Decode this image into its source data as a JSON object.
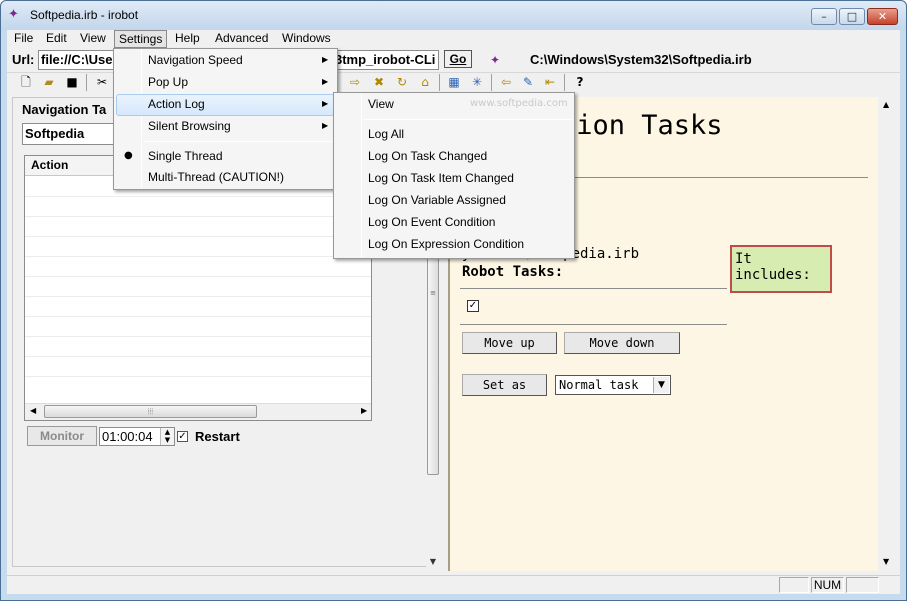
{
  "window": {
    "title": "Softpedia.irb - irobot",
    "minimize": "–",
    "maximize": "□",
    "close": "✕"
  },
  "menubar": {
    "items": [
      "File",
      "Edit",
      "View",
      "Settings",
      "Help",
      "Advanced",
      "Windows"
    ]
  },
  "urlbar": {
    "label": "Url:",
    "value": "file://C:\\Use",
    "value_tail": "3tmp_irobot-CLi",
    "go": "Go",
    "path": "C:\\Windows\\System32\\Softpedia.irb"
  },
  "left": {
    "title": "Navigation Ta",
    "combo_value": "Softpedia",
    "list_header": "Action",
    "monitor": "Monitor",
    "time": "01:00:04",
    "restart": "Restart"
  },
  "settings_menu": {
    "items": [
      {
        "label": "Navigation Speed"
      },
      {
        "label": "Pop Up"
      },
      {
        "label": "Action Log"
      },
      {
        "label": "Silent Browsing"
      },
      {
        "label": "Single Thread"
      },
      {
        "label": "Multi-Thread (CAUTION!)"
      }
    ]
  },
  "action_log_menu": {
    "items": [
      {
        "label": "View"
      },
      {
        "label": "Log All"
      },
      {
        "label": "Log On Task Changed"
      },
      {
        "label": "Log On Task Item Changed"
      },
      {
        "label": "Log On Variable Assigned"
      },
      {
        "label": "Log On Event Condition"
      },
      {
        "label": "Log On Expression Condition"
      }
    ],
    "watermark": "www.softpedia.com"
  },
  "doc": {
    "title": "tion Tasks",
    "path": "ystem32\\Softpedia.irb",
    "robot_tasks": "Robot Tasks:",
    "move_up": "Move up",
    "move_down": "Move down",
    "set_as": "Set as",
    "task_type": "Normal task",
    "includes": "It includes:"
  },
  "statusbar": {
    "num": "NUM"
  },
  "colors": {
    "doc_background": "#fdf6e4",
    "includes_fill": "#d6ecb0",
    "includes_border": "#c14b4b",
    "menu_highlight": "#d6e8fb"
  }
}
